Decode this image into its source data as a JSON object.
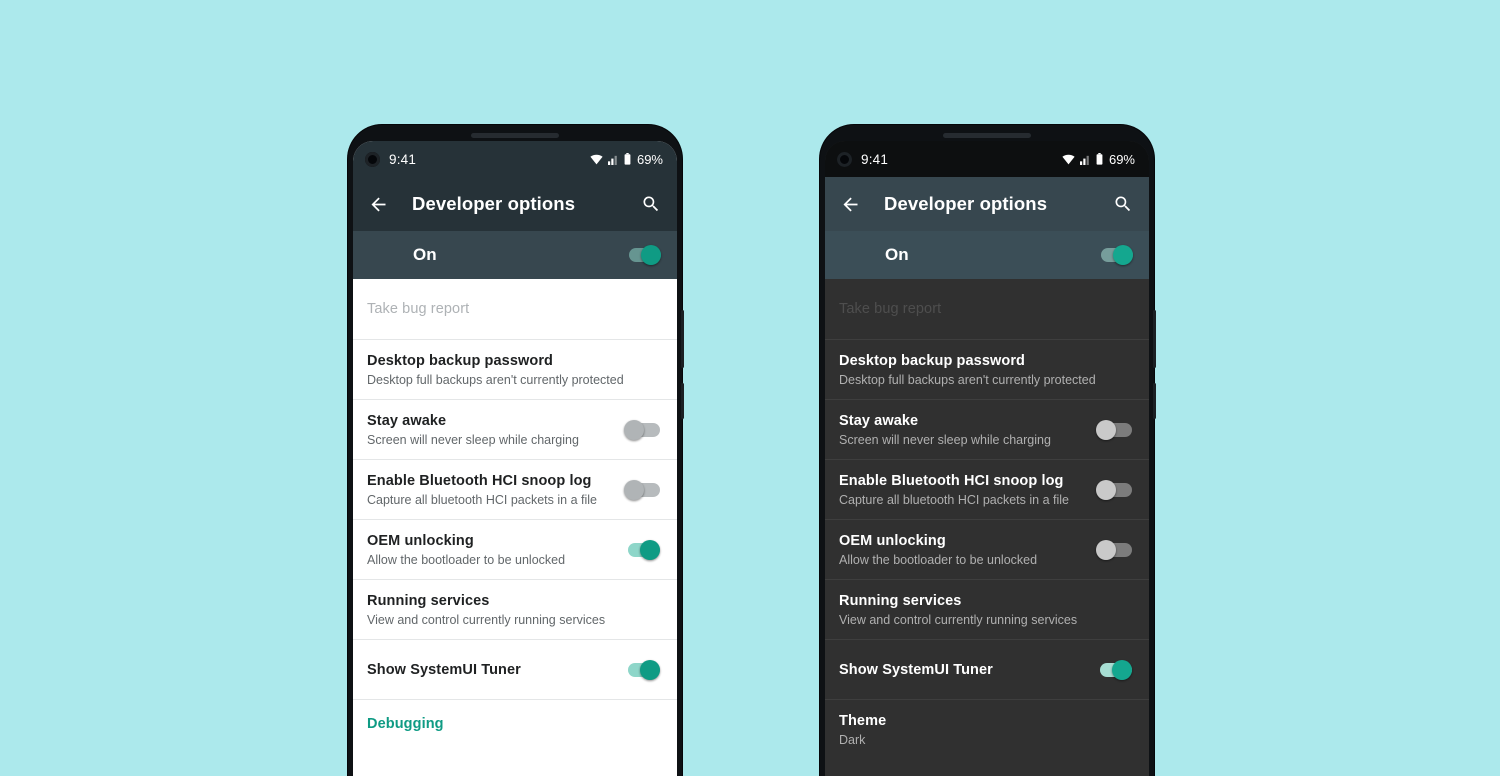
{
  "background_color": "#ace9ec",
  "accent_color": "#0f9b84",
  "phones": [
    {
      "id": "light",
      "theme": "light",
      "status": {
        "clock": "9:41",
        "battery_percent": "69%",
        "wifi_icon": "wifi-icon",
        "signal_icon": "signal-icon",
        "battery_icon": "battery-icon"
      },
      "appbar": {
        "back_icon": "back-arrow-icon",
        "title": "Developer options",
        "search_icon": "search-icon"
      },
      "master": {
        "label": "On",
        "state": "on"
      },
      "rows": [
        {
          "kind": "disabled",
          "title": "Take bug report",
          "subtitle": "",
          "control": "none"
        },
        {
          "kind": "item",
          "title": "Desktop backup password",
          "subtitle": "Desktop full backups aren't currently protected",
          "control": "none"
        },
        {
          "kind": "item",
          "title": "Stay awake",
          "subtitle": "Screen will never sleep while charging",
          "control": "switch",
          "state": "off"
        },
        {
          "kind": "item",
          "title": "Enable Bluetooth HCI snoop log",
          "subtitle": "Capture all bluetooth HCI packets in a file",
          "control": "switch",
          "state": "off"
        },
        {
          "kind": "item",
          "title": "OEM unlocking",
          "subtitle": "Allow the bootloader to be unlocked",
          "control": "switch",
          "state": "on"
        },
        {
          "kind": "item",
          "title": "Running services",
          "subtitle": "View and control currently running services",
          "control": "none"
        },
        {
          "kind": "item",
          "title": "Show SystemUI Tuner",
          "subtitle": "",
          "control": "switch",
          "state": "on"
        },
        {
          "kind": "section",
          "title": "Debugging",
          "subtitle": "",
          "control": "none"
        }
      ]
    },
    {
      "id": "dark",
      "theme": "dark",
      "status": {
        "clock": "9:41",
        "battery_percent": "69%",
        "wifi_icon": "wifi-icon",
        "signal_icon": "signal-icon",
        "battery_icon": "battery-icon"
      },
      "appbar": {
        "back_icon": "back-arrow-icon",
        "title": "Developer options",
        "search_icon": "search-icon"
      },
      "master": {
        "label": "On",
        "state": "on"
      },
      "rows": [
        {
          "kind": "disabled",
          "title": "Take bug report",
          "subtitle": "",
          "control": "none"
        },
        {
          "kind": "item",
          "title": "Desktop backup password",
          "subtitle": "Desktop full backups aren't currently protected",
          "control": "none"
        },
        {
          "kind": "item",
          "title": "Stay awake",
          "subtitle": "Screen will never sleep while charging",
          "control": "switch",
          "state": "off"
        },
        {
          "kind": "item",
          "title": "Enable Bluetooth HCI snoop log",
          "subtitle": "Capture all bluetooth HCI packets in a file",
          "control": "switch",
          "state": "off"
        },
        {
          "kind": "item",
          "title": "OEM unlocking",
          "subtitle": "Allow the bootloader to be unlocked",
          "control": "switch",
          "state": "off"
        },
        {
          "kind": "item",
          "title": "Running services",
          "subtitle": "View and control currently running services",
          "control": "none"
        },
        {
          "kind": "item",
          "title": "Show SystemUI Tuner",
          "subtitle": "",
          "control": "switch",
          "state": "on"
        },
        {
          "kind": "item",
          "title": "Theme",
          "subtitle": "Dark",
          "control": "none"
        }
      ]
    }
  ]
}
